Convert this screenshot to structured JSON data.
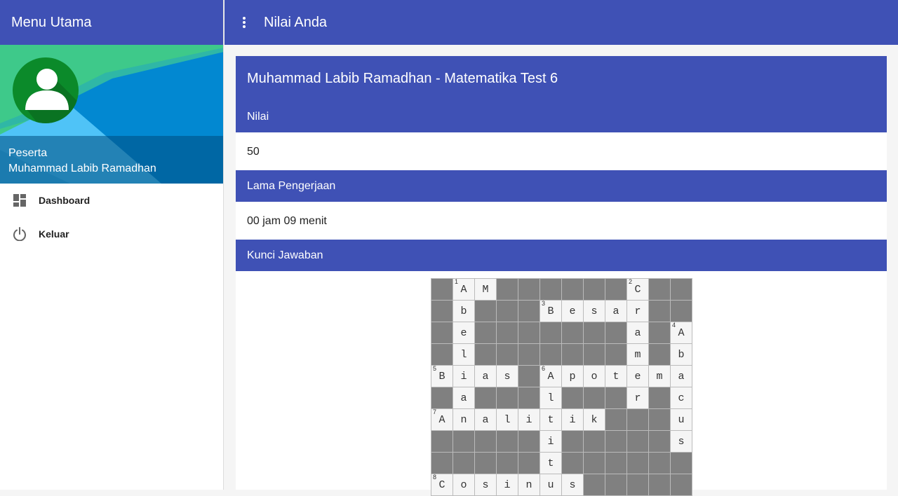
{
  "sidebar": {
    "title": "Menu Utama",
    "profile": {
      "role": "Peserta",
      "name": "Muhammad Labib Ramadhan"
    },
    "items": [
      {
        "label": "Dashboard",
        "icon": "dashboard-icon"
      },
      {
        "label": "Keluar",
        "icon": "power-icon"
      }
    ]
  },
  "topbar": {
    "title": "Nilai Anda",
    "menu_icon": "more-vert-icon"
  },
  "result": {
    "title": "Muhammad Labib Ramadhan - Matematika Test 6",
    "nilai_label": "Nilai",
    "nilai_value": "50",
    "lama_label": "Lama Pengerjaan",
    "lama_value": "00 jam 09 menit",
    "kunci_label": "Kunci Jawaban"
  },
  "crossword": {
    "rows": [
      [
        "#",
        "A",
        "M",
        "#",
        "#",
        "#",
        "#",
        "#",
        "#",
        "C",
        "#",
        "#"
      ],
      [
        "#",
        "b",
        "#",
        "#",
        "#",
        "B",
        "e",
        "s",
        "a",
        "r",
        "#",
        "#"
      ],
      [
        "#",
        "e",
        "#",
        "#",
        "#",
        "#",
        "#",
        "#",
        "#",
        "a",
        "#",
        "A"
      ],
      [
        "#",
        "l",
        "#",
        "#",
        "#",
        "#",
        "#",
        "#",
        "#",
        "m",
        "#",
        "b"
      ],
      [
        "B",
        "i",
        "a",
        "s",
        "#",
        "A",
        "p",
        "o",
        "t",
        "e",
        "m",
        "a"
      ],
      [
        "#",
        "a",
        "#",
        "#",
        "#",
        "l",
        "#",
        "#",
        "#",
        "r",
        "#",
        "c"
      ],
      [
        "A",
        "n",
        "a",
        "l",
        "i",
        "t",
        "i",
        "k",
        "#",
        "#",
        "#",
        "u"
      ],
      [
        "#",
        "#",
        "#",
        "#",
        "#",
        "i",
        "#",
        "#",
        "#",
        "#",
        "#",
        "s"
      ],
      [
        "#",
        "#",
        "#",
        "#",
        "#",
        "t",
        "#",
        "#",
        "#",
        "#",
        "#",
        "#"
      ],
      [
        "C",
        "o",
        "s",
        "i",
        "n",
        "u",
        "s",
        "#",
        "#",
        "#",
        "#",
        "#"
      ]
    ],
    "numbers": [
      {
        "r": 0,
        "c": 1,
        "n": "1"
      },
      {
        "r": 0,
        "c": 9,
        "n": "2"
      },
      {
        "r": 1,
        "c": 5,
        "n": "3"
      },
      {
        "r": 2,
        "c": 11,
        "n": "4"
      },
      {
        "r": 4,
        "c": 0,
        "n": "5"
      },
      {
        "r": 4,
        "c": 5,
        "n": "6"
      },
      {
        "r": 6,
        "c": 0,
        "n": "7"
      },
      {
        "r": 9,
        "c": 0,
        "n": "8"
      }
    ]
  }
}
